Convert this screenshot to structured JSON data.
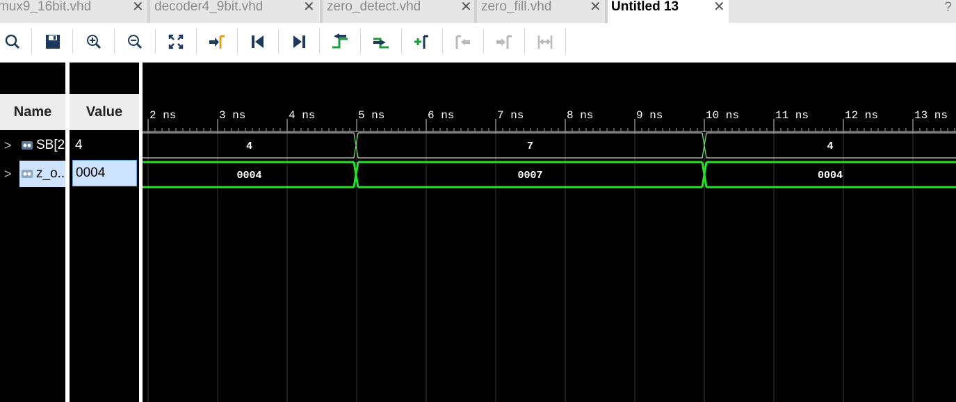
{
  "tabs": [
    {
      "label": "mux9_16bit.vhd",
      "active": false
    },
    {
      "label": "decoder4_9bit.vhd",
      "active": false
    },
    {
      "label": "zero_detect.vhd",
      "active": false
    },
    {
      "label": "zero_fill.vhd",
      "active": false
    },
    {
      "label": "Untitled 13",
      "active": true
    }
  ],
  "help": "?",
  "toolbar": {
    "icons": [
      "search-icon",
      "save-icon",
      "zoom-in-icon",
      "zoom-out-icon",
      "zoom-fit-icon",
      "go-to-cursor-icon",
      "go-to-time-zero-icon",
      "go-to-last-time-icon",
      "previous-transition-icon",
      "next-transition-icon",
      "add-marker-icon",
      "previous-marker-icon",
      "next-marker-icon",
      "swap-cursors-icon"
    ]
  },
  "columns": {
    "name": "Name",
    "value": "Value"
  },
  "signals": [
    {
      "name": "SB[2",
      "value": "4"
    },
    {
      "name": "z_o..",
      "value": "0004"
    }
  ],
  "timeline": {
    "ticks": [
      "2 ns",
      "3 ns",
      "4 ns",
      "5 ns",
      "6 ns",
      "7 ns",
      "8 ns",
      "9 ns",
      "10 ns",
      "11 ns",
      "12 ns",
      "13 ns"
    ],
    "bus1": [
      {
        "label": "4"
      },
      {
        "label": "7"
      },
      {
        "label": "4"
      }
    ],
    "bus2": [
      {
        "label": "0004"
      },
      {
        "label": "0007"
      },
      {
        "label": "0004"
      }
    ]
  },
  "colors": {
    "wave_green": "#27e02a",
    "bus_white": "#ffffff",
    "grid": "#3a3a3a"
  }
}
